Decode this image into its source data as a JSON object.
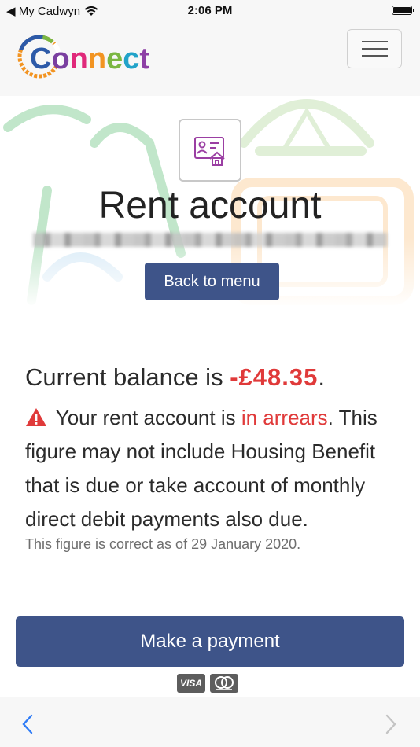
{
  "status_bar": {
    "carrier": "◀ My Cadwyn",
    "time": "2:06 PM"
  },
  "header": {
    "logo_text": "Connect",
    "logo_letter_colors": [
      "#2d5aa8",
      "#7a3fa0",
      "#e0297a",
      "#f29422",
      "#7bb742",
      "#22a3c9",
      "#8d3fa5"
    ],
    "menu_icon": "hamburger-icon"
  },
  "hero": {
    "icon": "rent-account-icon",
    "title": "Rent account",
    "back_label": "Back to menu"
  },
  "balance": {
    "prefix": "Current balance is ",
    "amount": "-£48.35",
    "suffix": ".",
    "warning_icon": "warning-icon",
    "arrears_text_before": " Your rent account is ",
    "arrears_highlight": "in arrears",
    "arrears_text_after": ". This figure may not include Housing Benefit that is due or take account of monthly direct debit payments also due.",
    "correct_as_of": "This figure is correct as of 29 January 2020."
  },
  "payment": {
    "button_label": "Make a payment",
    "visa_label": "VISA",
    "mastercard_icon": "mastercard-icon"
  },
  "colors": {
    "primary": "#3e5489",
    "alert": "#e03a3a"
  },
  "bottom_nav": {
    "back_icon": "chevron-left-icon",
    "forward_icon": "chevron-right-icon"
  }
}
